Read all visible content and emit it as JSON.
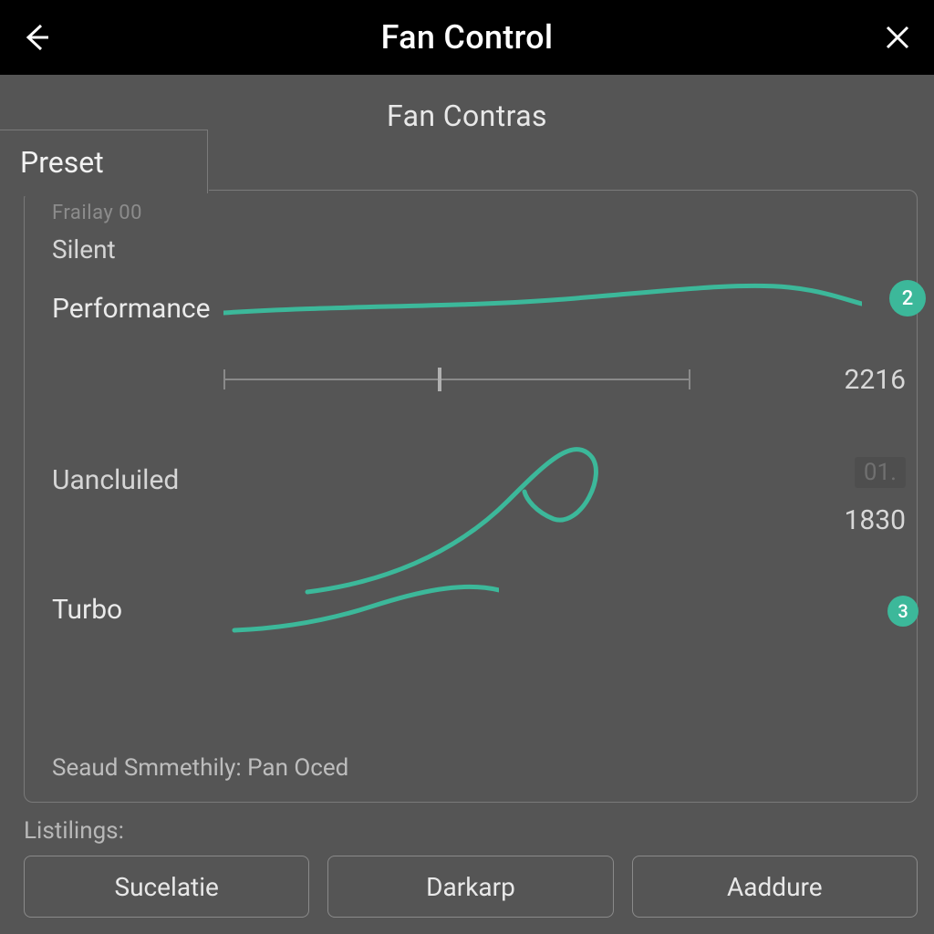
{
  "header": {
    "title": "Fan Control",
    "back_icon": "back-arrow-icon",
    "close_icon": "close-icon"
  },
  "subtitle": "Fan  Contras",
  "preset_tab_label": "Preset",
  "panel": {
    "partial_top_label": "Frailay 00",
    "silent_label": "Silent",
    "performance_label": "Performance",
    "performance_badge": "2",
    "slider_value": "2216",
    "uancluiled_label": "Uancluiled",
    "dimmed_value": "01.",
    "value_1830": "1830",
    "turbo_label": "Turbo",
    "turbo_badge": "3",
    "footer_text": "Seaud Smmethily: Pan Oced"
  },
  "listings_label": "Listilings:",
  "buttons": {
    "b1": "Sucelatie",
    "b2": "Darkarp",
    "b3": "Aaddure"
  },
  "colors": {
    "accent": "#3cb89a",
    "bg": "#555555",
    "header_bg": "#000000"
  }
}
